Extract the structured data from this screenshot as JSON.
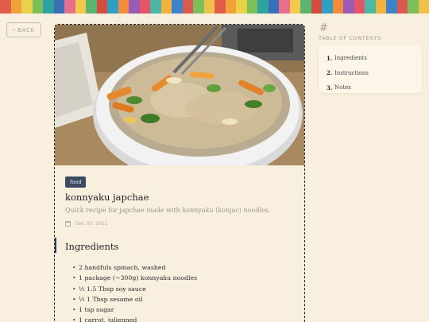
{
  "stripe_colors": [
    "#e25c4a",
    "#f0a23a",
    "#e9d24a",
    "#7cbf5a",
    "#2fa3a0",
    "#3a6fb8",
    "#e86f8c",
    "#f2c94c",
    "#5ab56e",
    "#d24d3e",
    "#2e9fc0",
    "#f08c3a",
    "#9b5bb5",
    "#e5556a",
    "#4bb7a5",
    "#f3b13d",
    "#3e83c7",
    "#d95a4e",
    "#7dc05b",
    "#eec14a"
  ],
  "back_button": {
    "label": "BACK"
  },
  "article": {
    "tag": "food",
    "title": "konnyaku japchae",
    "subtitle": "Quick recipe for japchae made with konnyaku (konjac) noodles.",
    "date": "Dec 05, 2021",
    "section_heading": "Ingredients",
    "ingredients": [
      "2 handfuls spinach, washed",
      "1 package (~300g) konnyaku noodles",
      "½ 1.5 Tbsp soy sauce",
      "½ 1 Tbsp sesame oil",
      "1 tsp sugar",
      "1 carrot, julienned"
    ]
  },
  "toc": {
    "hash": "#",
    "title": "TABLE OF CONTENTS",
    "items": [
      {
        "num": "1.",
        "label": "Ingredients"
      },
      {
        "num": "2.",
        "label": "Instructions"
      },
      {
        "num": "3.",
        "label": "Notes"
      }
    ]
  }
}
